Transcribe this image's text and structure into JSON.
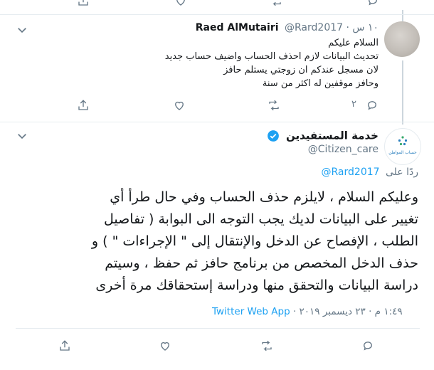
{
  "top_bar": {
    "icons": [
      "share-icon",
      "like-icon",
      "retweet-icon",
      "reply-icon"
    ]
  },
  "reply_tweet": {
    "author_name": "Raed AlMutairi",
    "handle": "@Rard2017",
    "time": "١٠ س",
    "lines": [
      "السلام عليكم",
      "تحديث البيانات لازم احذف الحساب واضيف حساب جديد",
      "لان مسجل عندكم ان زوجتي يستلم حافز",
      "وحافز موقفين له اكثر من سنة"
    ],
    "reply_count": "٢"
  },
  "main_tweet": {
    "author_name": "خدمة المستفيدين",
    "handle": "@Citizen_care",
    "avatar_caption": "حساب المواطن",
    "replying_prefix": "ردًا على",
    "replying_handle": "@Rard2017",
    "body_lines": [
      "وعليكم السلام ، لايلزم حذف الحساب وفي حال طرأ أي",
      "تغيير على البيانات لديك يجب التوجه الى البوابة ( تفاصيل",
      "الطلب ، الإفصاح عن الدخل والإنتقال إلى \" الإجراءات \" ) و",
      "حذف الدخل المخصص من برنامج حافز ثم حفظ ، وسيتم",
      "دراسة البيانات والتحقق منها ودراسة إستحقاقك مرة أخرى"
    ],
    "timestamp": "١:٤٩ م · ٢٣ ديسمبر ٢٠١٩",
    "source": "Twitter Web App",
    "source_separator": "·"
  },
  "colors": {
    "accent": "#1da1f2",
    "muted": "#657786",
    "verified": "#1da1f2",
    "thread_line": "#ccd6dd"
  }
}
